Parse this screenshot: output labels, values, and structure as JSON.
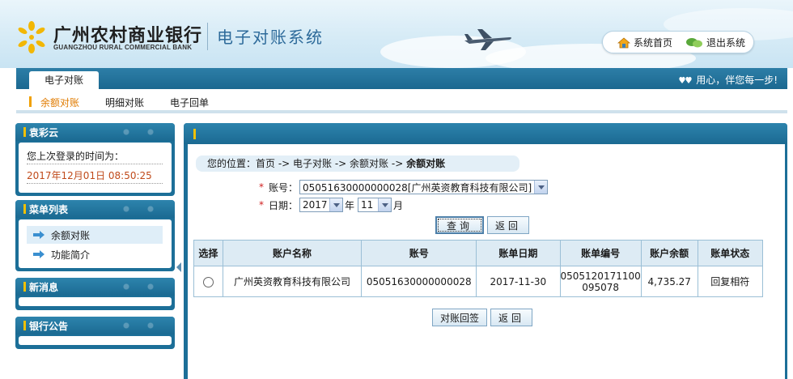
{
  "header": {
    "bank_name_cn": "广州农村商业银行",
    "bank_name_en": "GUANGZHOU RURAL COMMERCIAL BANK",
    "system_title": "电子对账系统",
    "links": [
      {
        "label": "系统首页",
        "icon": "home-icon"
      },
      {
        "label": "退出系统",
        "icon": "logout-icon"
      }
    ]
  },
  "nav": {
    "active_tab": "电子对账",
    "slogan": "用心，伴您每一步!",
    "sub_items": [
      {
        "label": "余额对账",
        "active": true
      },
      {
        "label": "明细对账",
        "active": false
      },
      {
        "label": "电子回单",
        "active": false
      }
    ]
  },
  "sidebar": {
    "user_panel": {
      "title": "袁彩云",
      "last_login_label": "您上次登录的时间为：",
      "last_login_time": "2017年12月01日  08:50:25"
    },
    "menu_panel": {
      "title": "菜单列表",
      "items": [
        {
          "label": "余额对账",
          "selected": true
        },
        {
          "label": "功能简介",
          "selected": false
        }
      ]
    },
    "news_panel": {
      "title": "新消息"
    },
    "notice_panel": {
      "title": "银行公告"
    }
  },
  "main": {
    "breadcrumb": {
      "prefix": "您的位置：",
      "path": "首页  ->  电子对账  ->  余额对账  ->",
      "current": "余额对账"
    },
    "form": {
      "account_label": "账号：",
      "account_value": "05051630000000028[广州英资教育科技有限公司]",
      "date_label": "日期：",
      "year_value": "2017",
      "year_suffix": "年",
      "month_value": "11",
      "month_suffix": "月"
    },
    "buttons": {
      "query": "查询",
      "back": "返回",
      "reply": "对账回签",
      "back2": "返回"
    },
    "table": {
      "headers": [
        "选择",
        "账户名称",
        "账号",
        "账单日期",
        "账单编号",
        "账户余额",
        "账单状态"
      ],
      "rows": [
        {
          "account_name": "广州英资教育科技有限公司",
          "account_no": "05051630000000028",
          "bill_date": "2017-11-30",
          "bill_no_line1": "0505120171100",
          "bill_no_line2": "095078",
          "balance": "4,735.27",
          "status": "回复相符"
        }
      ]
    }
  },
  "colors": {
    "primary_blue": "#1c6f98",
    "accent_orange": "#e07b00",
    "highlight_red": "#c04a1a"
  }
}
